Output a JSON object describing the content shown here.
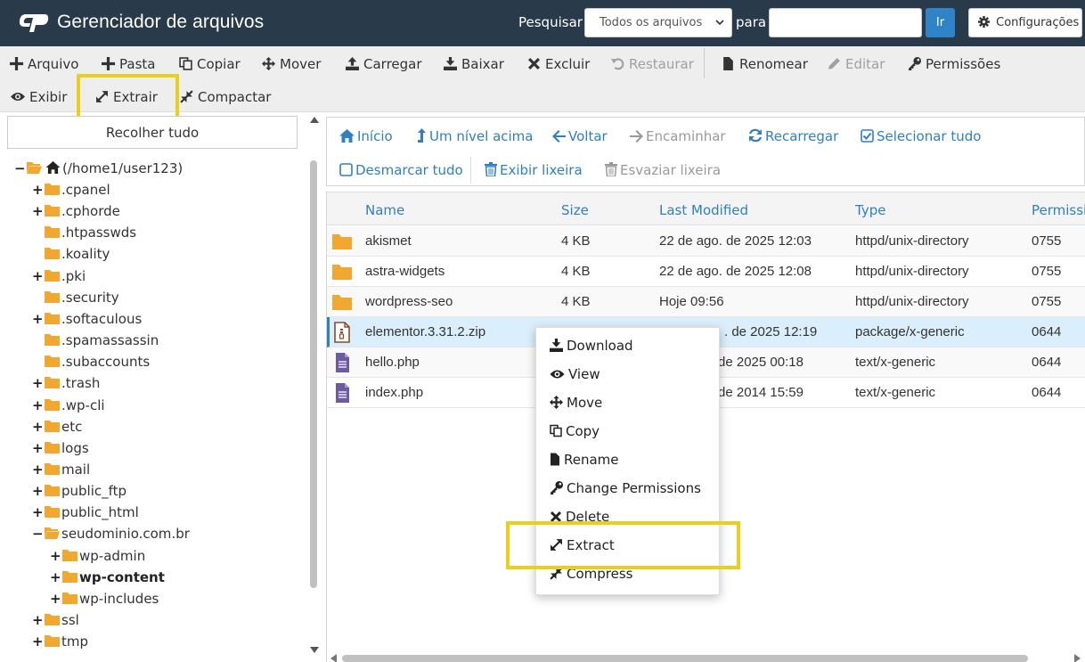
{
  "header": {
    "title": "Gerenciador de arquivos",
    "search_label": "Pesquisar",
    "search_scope": "Todos os arquivos",
    "for_label": "para",
    "search_value": "",
    "go_label": "Ir",
    "settings_label": "Configurações"
  },
  "toolbar": {
    "file": "Arquivo",
    "folder": "Pasta",
    "copy": "Copiar",
    "move": "Mover",
    "upload": "Carregar",
    "download": "Baixar",
    "delete": "Excluir",
    "restore": "Restaurar",
    "rename": "Renomear",
    "edit": "Editar",
    "permissions": "Permissões",
    "view": "Exibir",
    "extract": "Extrair",
    "compress": "Compactar"
  },
  "tree": {
    "collapse_all": "Recolher tudo",
    "root": "(/home1/user123)",
    "items": [
      {
        "label": ".cpanel",
        "toggle": "+"
      },
      {
        "label": ".cphorde",
        "toggle": "+"
      },
      {
        "label": ".htpasswds",
        "toggle": ""
      },
      {
        "label": ".koality",
        "toggle": ""
      },
      {
        "label": ".pki",
        "toggle": "+"
      },
      {
        "label": ".security",
        "toggle": ""
      },
      {
        "label": ".softaculous",
        "toggle": "+"
      },
      {
        "label": ".spamassassin",
        "toggle": ""
      },
      {
        "label": ".subaccounts",
        "toggle": ""
      },
      {
        "label": ".trash",
        "toggle": "+"
      },
      {
        "label": ".wp-cli",
        "toggle": "+"
      },
      {
        "label": "etc",
        "toggle": "+"
      },
      {
        "label": "logs",
        "toggle": "+"
      },
      {
        "label": "mail",
        "toggle": "+"
      },
      {
        "label": "public_ftp",
        "toggle": "+"
      },
      {
        "label": "public_html",
        "toggle": "+"
      },
      {
        "label": "seudominio.com.br",
        "toggle": "−"
      },
      {
        "label": "wp-admin",
        "toggle": "+"
      },
      {
        "label": "wp-content",
        "toggle": "+"
      },
      {
        "label": "wp-includes",
        "toggle": "+"
      },
      {
        "label": "ssl",
        "toggle": "+"
      },
      {
        "label": "tmp",
        "toggle": "+"
      }
    ]
  },
  "nav": {
    "home": "Início",
    "up": "Um nível acima",
    "back": "Voltar",
    "forward": "Encaminhar",
    "reload": "Recarregar",
    "select_all": "Selecionar tudo",
    "unselect_all": "Desmarcar tudo",
    "view_trash": "Exibir lixeira",
    "empty_trash": "Esvaziar lixeira"
  },
  "table": {
    "headers": {
      "name": "Name",
      "size": "Size",
      "modified": "Last Modified",
      "type": "Type",
      "perms": "Permissi"
    },
    "rows": [
      {
        "name": "akismet",
        "size": "4 KB",
        "modified": "22 de ago. de 2025 12:03",
        "type": "httpd/unix-directory",
        "perms": "0755"
      },
      {
        "name": "astra-widgets",
        "size": "4 KB",
        "modified": "22 de ago. de 2025 12:08",
        "type": "httpd/unix-directory",
        "perms": "0755"
      },
      {
        "name": "wordpress-seo",
        "size": "4 KB",
        "modified": "Hoje 09:56",
        "type": "httpd/unix-directory",
        "perms": "0755"
      },
      {
        "name": "elementor.3.31.2.zip",
        "size": "",
        "modified": ". de 2025 12:19",
        "type": "package/x-generic",
        "perms": "0644"
      },
      {
        "name": "hello.php",
        "size": "",
        "modified": "de 2025 00:18",
        "type": "text/x-generic",
        "perms": "0644"
      },
      {
        "name": "index.php",
        "size": "",
        "modified": "de 2014 15:59",
        "type": "text/x-generic",
        "perms": "0644"
      }
    ]
  },
  "context_menu": {
    "download": "Download",
    "view": "View",
    "move": "Move",
    "copy": "Copy",
    "rename": "Rename",
    "permissions": "Change Permissions",
    "delete": "Delete",
    "extract": "Extract",
    "compress": "Compress"
  },
  "colors": {
    "header_bg": "#293a4a",
    "link_blue": "#2f7fc1",
    "folder_orange": "#f0a830",
    "highlight_yellow": "#ecce1c",
    "selected_row": "#dbeefc"
  }
}
